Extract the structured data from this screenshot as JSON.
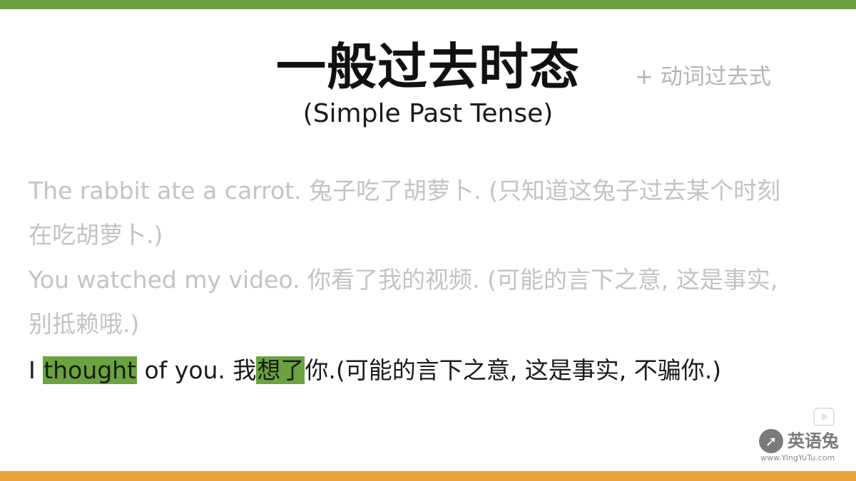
{
  "slide": {
    "title": "一般过去时态",
    "subtitle": "(Simple Past Tense)",
    "side_note": "+ 动词过去式",
    "examples": [
      {
        "line1": "The rabbit ate a carrot. 兔子吃了胡萝卜. (只知道这兔子过去某个时刻",
        "line2": "在吃胡萝卜.)"
      },
      {
        "line1": "You watched my video. 你看了我的视频. (可能的言下之意, 这是事实,",
        "line2": "别抵赖哦.)"
      },
      {
        "pre": "I ",
        "highlight1": "thought",
        "mid": " of you. 我",
        "highlight2": "想了",
        "post": "你.(可能的言下之意, 这是事实, 不骗你.)"
      }
    ],
    "colors": {
      "top_bar": "#6aa33f",
      "bottom_bar": "#e8a13a",
      "highlight": "#6aa33f",
      "faded_text": "#c3c3c3"
    }
  },
  "watermark": {
    "icon": "rabbit-logo-icon",
    "name": "英语兔",
    "url": "www.YingYuTu.com"
  }
}
